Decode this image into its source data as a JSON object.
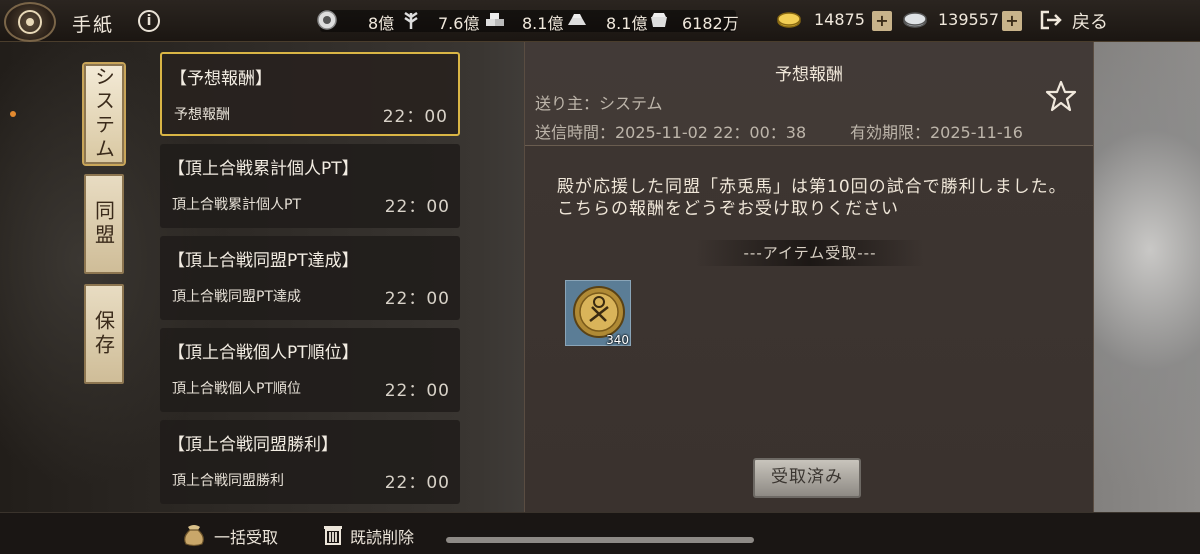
{
  "header": {
    "title": "手紙",
    "resources": [
      {
        "icon": "rice-icon",
        "value": "8億"
      },
      {
        "icon": "lumber-icon",
        "value": "7.6億"
      },
      {
        "icon": "stone-icon",
        "value": "8.1億"
      },
      {
        "icon": "iron-icon",
        "value": "8.1億"
      },
      {
        "icon": "gold-ingot-icon",
        "value": "6182万"
      }
    ],
    "gold": "14875",
    "silver": "139557",
    "back_label": "戻る"
  },
  "tabs": [
    {
      "label": "システム",
      "active": true
    },
    {
      "label": "同盟",
      "active": false
    },
    {
      "label": "保存",
      "active": false
    }
  ],
  "mails": [
    {
      "title": "【予想報酬】",
      "subject": "予想報酬",
      "time": "22：00",
      "selected": true
    },
    {
      "title": "【頂上合戦累計個人PT】",
      "subject": "頂上合戦累計個人PT",
      "time": "22：00",
      "selected": false
    },
    {
      "title": "【頂上合戦同盟PT達成】",
      "subject": "頂上合戦同盟PT達成",
      "time": "22：00",
      "selected": false
    },
    {
      "title": "【頂上合戦個人PT順位】",
      "subject": "頂上合戦個人PT順位",
      "time": "22：00",
      "selected": false
    },
    {
      "title": "【頂上合戦同盟勝利】",
      "subject": "頂上合戦同盟勝利",
      "time": "22：00",
      "selected": false
    }
  ],
  "detail": {
    "title": "予想報酬",
    "sender": "送り主：システム",
    "sent": "送信時間：2025-11-02 22：00：38",
    "expire": "有効期限：2025-11-16",
    "body": "殿が応援した同盟「赤兎馬」は第10回の試合で勝利しました。こちらの報酬をどうぞお受け取りください",
    "items_header": "---アイテム受取---",
    "item": {
      "icon": "coin-icon",
      "count": "340"
    },
    "claimed_label": "受取済み"
  },
  "footer": {
    "bulk_claim": "一括受取",
    "delete_read": "既読削除"
  },
  "colors": {
    "accent": "#d9b545",
    "tab_bg": "#e8dcc2",
    "unread_dot": "#e38a2f"
  }
}
